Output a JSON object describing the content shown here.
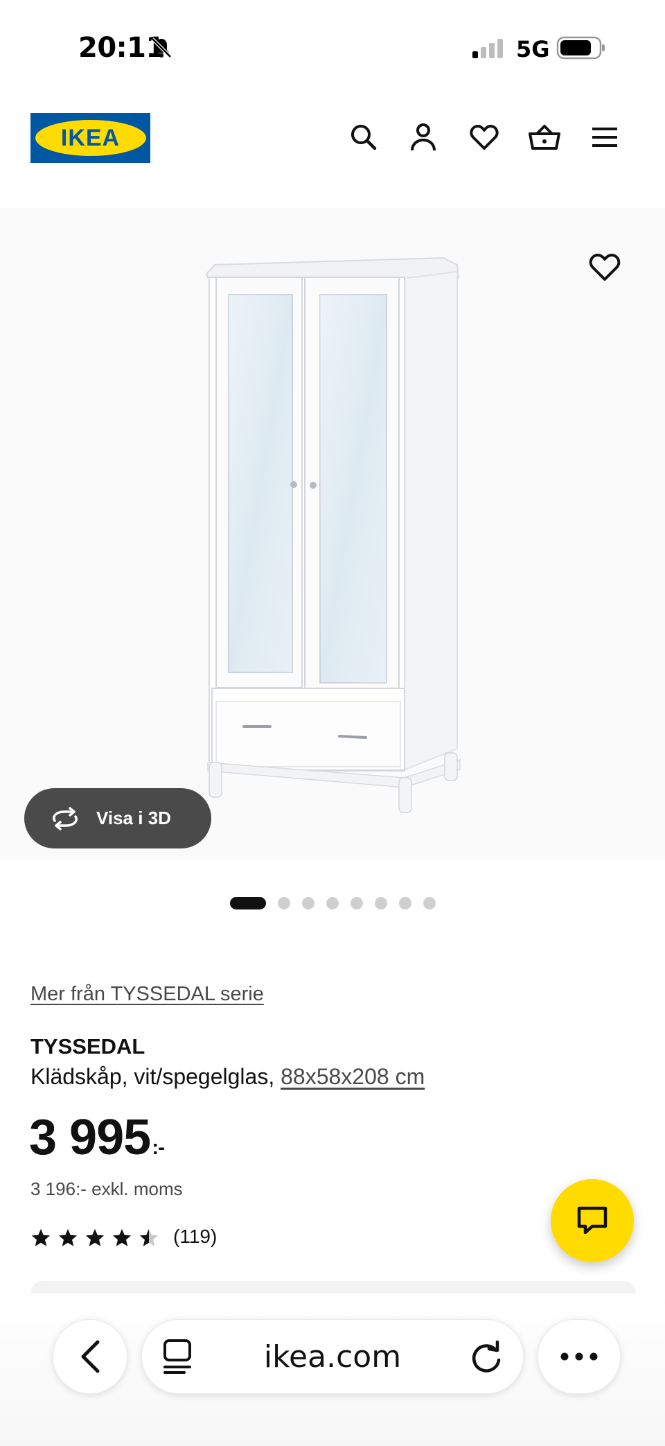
{
  "status_bar": {
    "time": "20:11",
    "network": "5G",
    "icons": [
      "bell-slash-icon",
      "signal-icon",
      "battery-icon"
    ]
  },
  "header": {
    "logo_text": "IKEA",
    "icons": [
      "search-icon",
      "account-icon",
      "favorites-icon",
      "cart-icon",
      "menu-icon"
    ]
  },
  "gallery": {
    "view_3d_label": "Visa i 3D",
    "image_count": 8,
    "current_image": 1
  },
  "product": {
    "series_link": "Mer från TYSSEDAL serie",
    "name": "TYSSEDAL",
    "description": "Klädskåp, vit/spegelglas, ",
    "dimensions": "88x58x208 cm",
    "price_main": "3 995",
    "price_suffix": ":-",
    "price_excl_vat": "3 196:- exkl. moms",
    "rating": 4.5,
    "rating_count": "(119)"
  },
  "browser": {
    "url": "ikea.com",
    "icons": [
      "back-icon",
      "reader-icon",
      "reload-icon",
      "more-icon"
    ]
  },
  "colors": {
    "ikea_blue": "#0058a3",
    "ikea_yellow": "#ffdb00",
    "dark_button": "#4a4a4a",
    "text": "#111111",
    "muted_text": "#484848"
  }
}
